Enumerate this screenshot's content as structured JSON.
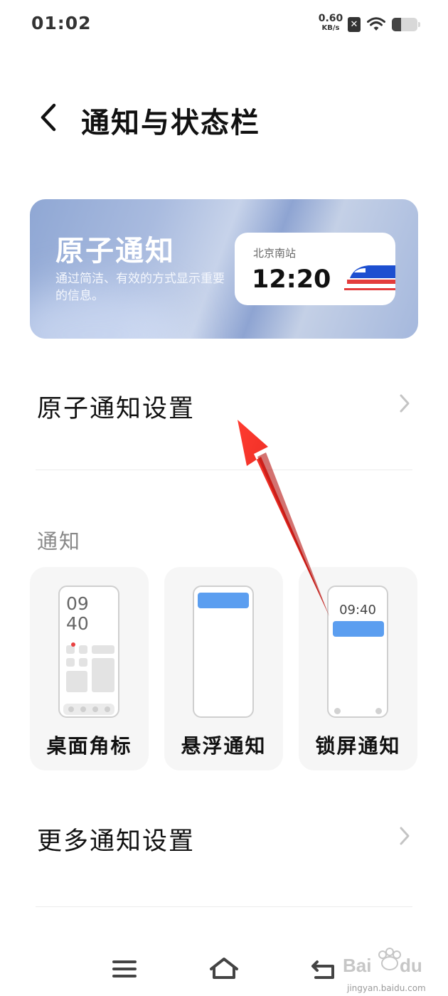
{
  "status_bar": {
    "time": "01:02",
    "net_speed_value": "0.60",
    "net_speed_unit": "KB/s",
    "sim_icon": "x-mark-icon",
    "wifi_icon": "wifi-icon",
    "battery_level": 0.35
  },
  "header": {
    "back_icon": "chevron-left-icon",
    "title": "通知与状态栏"
  },
  "banner": {
    "title": "原子通知",
    "description": "通过简洁、有效的方式显示重要的信息。",
    "ticket": {
      "station": "北京南站",
      "time": "12:20",
      "icon": "train-icon"
    }
  },
  "atomic_settings_row": {
    "label": "原子通知设置",
    "icon": "chevron-right-icon"
  },
  "notifications_section": {
    "title": "通知",
    "cards": [
      {
        "label": "桌面角标",
        "preview_clock_line1": "09",
        "preview_clock_line2": "40"
      },
      {
        "label": "悬浮通知"
      },
      {
        "label": "锁屏通知",
        "preview_clock": "09:40"
      }
    ]
  },
  "more_settings_row": {
    "label": "更多通知设置",
    "icon": "chevron-right-icon"
  },
  "nav_bar": {
    "menu_icon": "menu-icon",
    "home_icon": "home-icon",
    "back_icon": "return-icon"
  },
  "watermark": {
    "brand": "Bai du 经验",
    "url": "jingyan.baidu.com"
  },
  "colors": {
    "accent_blue": "#5b9ef0",
    "annotation_red": "#e8231f",
    "card_bg": "#f6f6f6"
  }
}
